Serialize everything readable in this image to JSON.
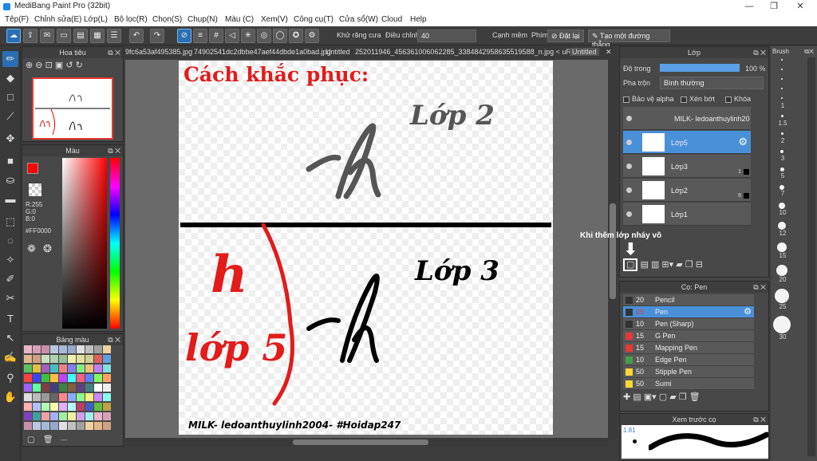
{
  "window": {
    "title": "MediBang Paint Pro (32bit)",
    "min": "—",
    "max": "❐",
    "close": "✕"
  },
  "menu": [
    "Tệp(F)",
    "Chỉnh sửa(E)",
    "Lớp(L)",
    "Bộ lọc(R)",
    "Chọn(S)",
    "Chụp(N)",
    "Màu (C)",
    "Xem(V)",
    "Công cụ(T)",
    "Cửa sổ(W)",
    "Cloud",
    "Help"
  ],
  "toolbar": {
    "antialias_label": "Khử răng cưa",
    "adjust_label": "Điều chỉnh",
    "adjust_value": "40",
    "smooth_label": "Cạnh mềm",
    "key_label": "Phím",
    "reset_label": "Đặt lại",
    "straight_label": "Tạo một đường thẳng"
  },
  "doc_tabs": [
    "9fc6a53af495385.jpg",
    "74902541dc2dbbe47aef44dbde1a0bad.jpg",
    "Untitled",
    "252011946_456361006062285_3384842958635519588_n.jpg < uRGB >",
    "Untitled"
  ],
  "navigator": {
    "title": "Hoa tiêu"
  },
  "color_panel": {
    "title": "Màu",
    "r": "R:255",
    "g": "G:0",
    "b": "B:0",
    "hex": "#FF0000",
    "primary": "#FF0000"
  },
  "swatch_panel": {
    "title": "Bảng màu",
    "footer": "---"
  },
  "layer_panel": {
    "title": "Lớp",
    "opacity_label": "Độ trong",
    "opacity_value": "100 %",
    "blend_label": "Pha trộn",
    "blend_value": "Bình thường",
    "protect_alpha": "Bảo vệ alpha",
    "clip": "Xén bớt",
    "lock": "Khóa",
    "layers": [
      {
        "name": "MILK- ledoanthuylinh20",
        "selected": false
      },
      {
        "name": "Lớp5",
        "selected": true
      },
      {
        "name": "Lớp3",
        "selected": false
      },
      {
        "name": "Lớp2",
        "selected": false
      },
      {
        "name": "Lớp1",
        "selected": false
      }
    ],
    "layer_nums": [
      "1",
      "8"
    ]
  },
  "annotation": "Khi thêm lớp nháy vô",
  "brush_panel": {
    "title": "Cọ: Pen",
    "brushes": [
      {
        "size": "20",
        "name": "Pencil",
        "color": "#333333",
        "selected": false
      },
      {
        "size": "25",
        "name": "Pen",
        "color": "#333333",
        "selected": true
      },
      {
        "size": "10",
        "name": "Pen (Sharp)",
        "color": "#333333",
        "selected": false
      },
      {
        "size": "15",
        "name": "G Pen",
        "color": "#e53935",
        "selected": false
      },
      {
        "size": "15",
        "name": "Mapping Pen",
        "color": "#e53935",
        "selected": false
      },
      {
        "size": "10",
        "name": "Edge Pen",
        "color": "#43a047",
        "selected": false
      },
      {
        "size": "50",
        "name": "Stipple Pen",
        "color": "#fdd835",
        "selected": false
      },
      {
        "size": "50",
        "name": "Sumi",
        "color": "#fdd835",
        "selected": false
      }
    ]
  },
  "preview_panel": {
    "title": "Xem trước cọ",
    "size": "1.81"
  },
  "size_strip": {
    "title": "Brush",
    "labels": [
      "1",
      "1.5",
      "2",
      "3",
      "5",
      "7",
      "10",
      "12",
      "15",
      "20",
      "25",
      "30"
    ]
  },
  "canvas": {
    "heading": "Cách khắc phục:",
    "label_layer2": "Lớp 2",
    "label_layer3": "Lớp 3",
    "label_layer5": "lớp 5",
    "glyph": "h",
    "watermark": "MILK- ledoanthuylinh2004- #Hoidap247"
  }
}
